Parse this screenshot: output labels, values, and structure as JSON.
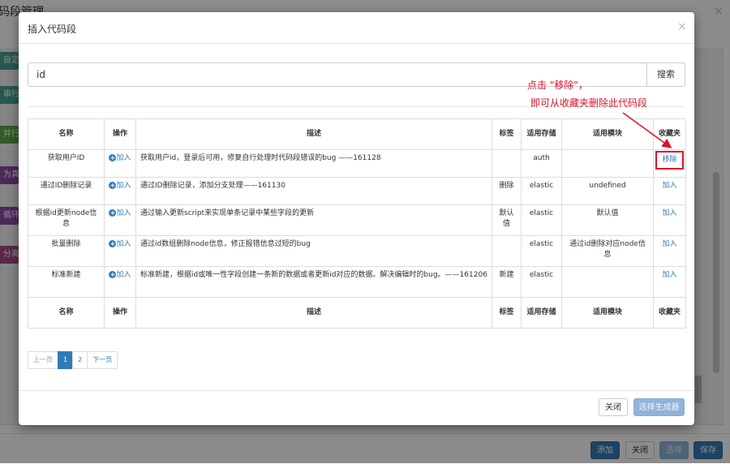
{
  "background": {
    "title": "码段管理",
    "close": "×",
    "sidebar_pills": [
      {
        "label": "自定",
        "color": "#4a9e8e"
      },
      {
        "label": "串行",
        "color": "#4a9e8e"
      },
      {
        "label": "并行",
        "color": "#5aa64a"
      },
      {
        "label": "为真",
        "color": "#8a4aa6"
      },
      {
        "label": "循环",
        "color": "#8a4aa6"
      },
      {
        "label": "分离",
        "color": "#a64a8a"
      }
    ],
    "buttons": {
      "add": "添加",
      "close": "关闭",
      "select": "选择",
      "save": "保存"
    }
  },
  "modal": {
    "title": "插入代码段",
    "close": "×",
    "search": {
      "value": "id",
      "button": "搜索"
    },
    "table": {
      "headers": [
        "名称",
        "操作",
        "描述",
        "标签",
        "适用存储",
        "适用模块",
        "收藏夹"
      ],
      "rows": [
        {
          "name": "获取用户ID",
          "op": "加入",
          "desc": "获取用户id，登录后可用，修复自行处理时代码段错误的bug ——161128",
          "tag": "",
          "storage": "auth",
          "module": "",
          "fav": "移除",
          "fav_highlight": true
        },
        {
          "name": "通过ID删除记录",
          "op": "加入",
          "desc": "通过ID删除记录，添加分支处理——161130",
          "tag": "删除",
          "storage": "elastic",
          "module": "undefined",
          "fav": "加入",
          "fav_highlight": false
        },
        {
          "name": "根据id更新node信息",
          "op": "加入",
          "desc": "通过输入更新script来实现单条记录中某些字段的更新",
          "tag": "默认值",
          "storage": "elastic",
          "module": "默认值",
          "fav": "加入",
          "fav_highlight": false
        },
        {
          "name": "批量删除",
          "op": "加入",
          "desc": "通过id数组删除node信息，修正报错信息过短的bug",
          "tag": "",
          "storage": "elastic",
          "module": "通过id删除对应node信息",
          "fav": "加入",
          "fav_highlight": false
        },
        {
          "name": "标准新建",
          "op": "加入",
          "desc": "标准新建，根据id或唯一性字段创建一条新的数据或者更新id对应的数据。解决编辑时的bug。——161206",
          "tag": "新建",
          "storage": "elastic",
          "module": "",
          "fav": "加入",
          "fav_highlight": false
        }
      ]
    },
    "pagination": {
      "prev": "上一页",
      "pages": [
        "1",
        "2"
      ],
      "active": "1",
      "next": "下一页"
    },
    "footer": {
      "close": "关闭",
      "select_generator": "选择生成器"
    }
  },
  "annotation": {
    "line1": "点击 \"移除\"，",
    "line2": "即可从收藏夹删除此代码段",
    "color": "#e0102a"
  }
}
